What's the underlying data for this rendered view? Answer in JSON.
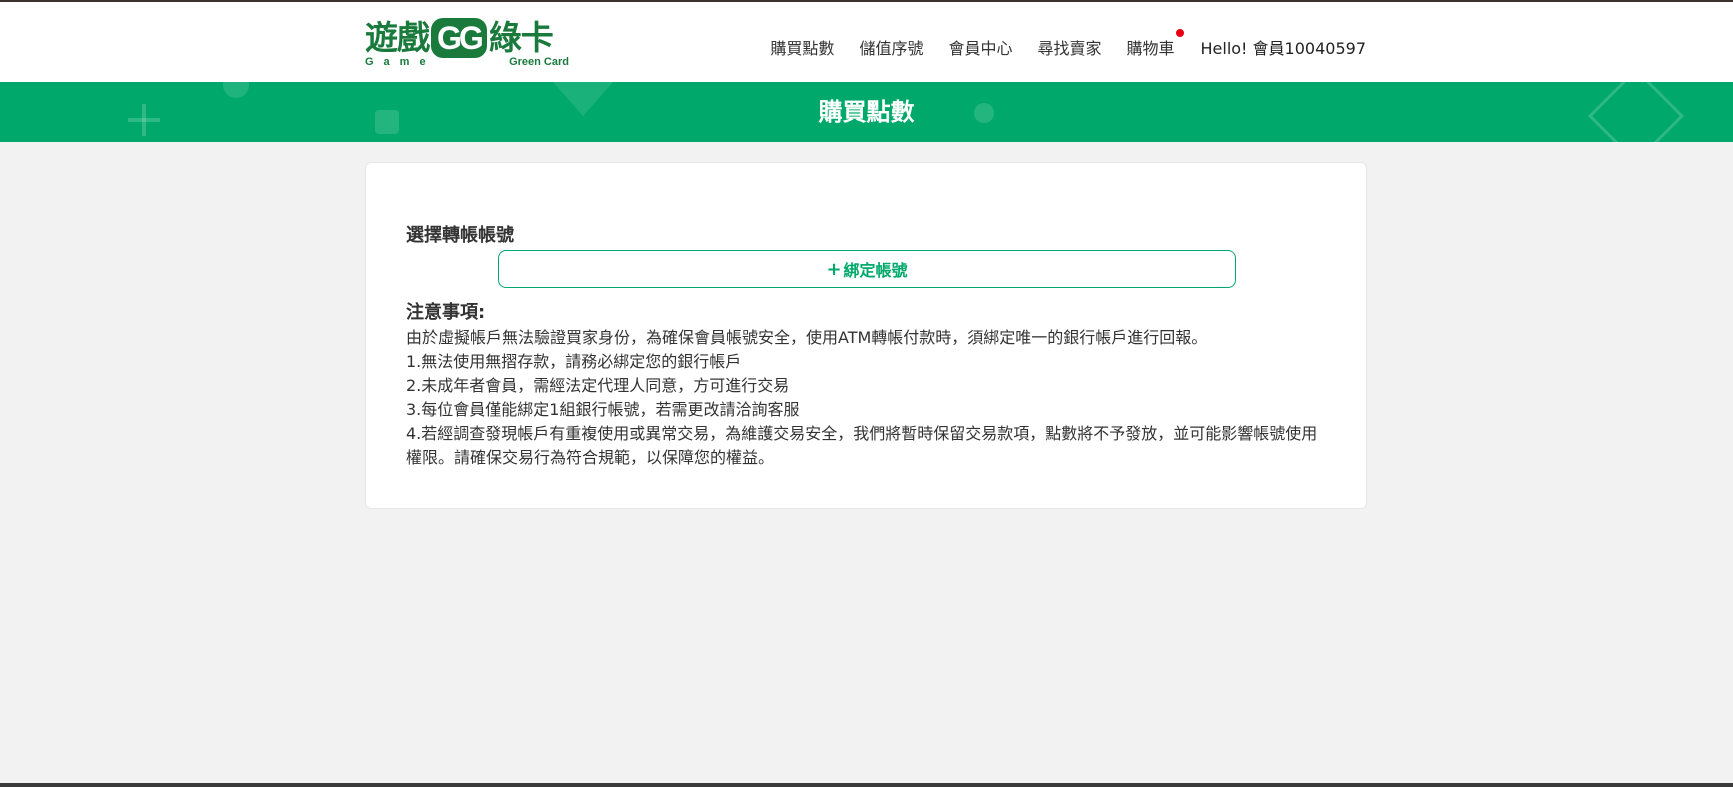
{
  "header": {
    "logo": {
      "title_left": "遊戲",
      "title_mid": "GG",
      "title_right": "綠卡",
      "sub_left": "Game",
      "sub_right": "Green Card"
    },
    "nav": [
      {
        "label": "購買點數"
      },
      {
        "label": "儲值序號"
      },
      {
        "label": "會員中心"
      },
      {
        "label": "尋找賣家"
      },
      {
        "label": "購物車"
      }
    ],
    "greeting": "Hello! 會員10040597"
  },
  "banner": {
    "title": "購買點數"
  },
  "card": {
    "section_label": "選擇轉帳帳號",
    "bind_button": {
      "icon": "plus-icon",
      "label": "綁定帳號"
    },
    "notice": {
      "title": "注意事項:",
      "lines": [
        "由於虛擬帳戶無法驗證買家身份，為確保會員帳號安全，使用ATM轉帳付款時，須綁定唯一的銀行帳戶進行回報。",
        "1.無法使用無摺存款，請務必綁定您的銀行帳戶",
        "2.未成年者會員，需經法定代理人同意，方可進行交易",
        "3.每位會員僅能綁定1組銀行帳號，若需更改請洽詢客服",
        "4.若經調查發現帳戶有重複使用或異常交易，為維護交易安全，我們將暫時保留交易款項，點數將不予發放，並可能影響帳號使用權限。請確保交易行為符合規範，以保障您的權益。"
      ]
    }
  },
  "colors": {
    "brand_green": "#00a96b",
    "logo_green": "#1a7a3c",
    "cart_dot": "#e60012"
  }
}
